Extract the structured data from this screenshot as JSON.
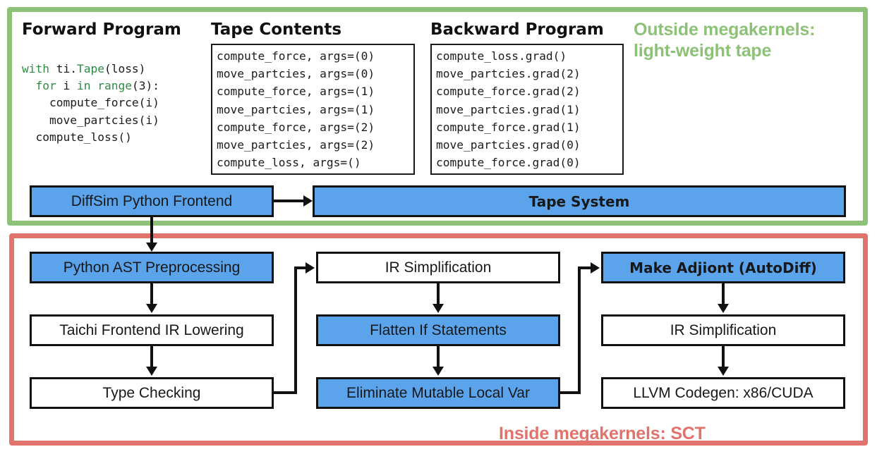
{
  "colors": {
    "green": "#8CC177",
    "red": "#E0736B",
    "blue": "#5BA4EC",
    "outline": "#111111",
    "code_keyword": "#2E8B45"
  },
  "regions": {
    "outside": {
      "annotation": "Outside megakernels:\nlight-weight tape"
    },
    "inside": {
      "annotation": "Inside megakernels: SCT"
    }
  },
  "columns": {
    "forward": {
      "heading": "Forward Program",
      "code_lines": [
        "with ti.Tape(loss)",
        "  for i in range(3):",
        "    compute_force(i)",
        "    move_partcies(i)",
        "  compute_loss()"
      ],
      "code_text": "with ti.Tape(loss)\n  for i in range(3):\n    compute_force(i)\n    move_partcies(i)\n  compute_loss()"
    },
    "tape": {
      "heading": "Tape Contents",
      "entries": [
        "compute_force, args=(0)",
        "move_partcies, args=(0)",
        "compute_force, args=(1)",
        "move_partcies, args=(1)",
        "compute_force, args=(2)",
        "move_partcies, args=(2)",
        "compute_loss, args=()"
      ],
      "entries_text": "compute_force, args=(0)\nmove_partcies, args=(0)\ncompute_force, args=(1)\nmove_partcies, args=(1)\ncompute_force, args=(2)\nmove_partcies, args=(2)\ncompute_loss, args=()"
    },
    "backward": {
      "heading": "Backward Program",
      "entries": [
        "compute_loss.grad()",
        "move_partcies.grad(2)",
        "compute_force.grad(2)",
        "move_partcies.grad(1)",
        "compute_force.grad(1)",
        "move_partcies.grad(0)",
        "compute_force.grad(0)"
      ],
      "entries_text": "compute_loss.grad()\nmove_partcies.grad(2)\ncompute_force.grad(2)\nmove_partcies.grad(1)\ncompute_force.grad(1)\nmove_partcies.grad(0)\ncompute_force.grad(0)"
    }
  },
  "nodes": {
    "frontend": {
      "label": "DiffSim Python Frontend",
      "fill": "blue"
    },
    "tape_system": {
      "label": "Tape System",
      "fill": "blue"
    },
    "ast": {
      "label": "Python AST Preprocessing",
      "fill": "blue"
    },
    "lowering": {
      "label": "Taichi Frontend IR Lowering",
      "fill": "white"
    },
    "typecheck": {
      "label": "Type Checking",
      "fill": "white"
    },
    "ir_simplification_1": {
      "label": "IR Simplification",
      "fill": "white"
    },
    "flatten": {
      "label": "Flatten If Statements",
      "fill": "blue"
    },
    "eliminate": {
      "label": "Eliminate Mutable Local Var",
      "fill": "blue"
    },
    "adjoint": {
      "label": "Make Adjiont (AutoDiff)",
      "fill": "blue"
    },
    "ir_simplification_2": {
      "label": "IR Simplification",
      "fill": "white"
    },
    "llvm": {
      "label": "LLVM Codegen: x86/CUDA",
      "fill": "white"
    }
  },
  "edges": [
    {
      "from": "frontend",
      "to": "tape_system"
    },
    {
      "from": "frontend",
      "to": "ast"
    },
    {
      "from": "ast",
      "to": "lowering"
    },
    {
      "from": "lowering",
      "to": "typecheck"
    },
    {
      "from": "typecheck",
      "to": "ir_simplification_1"
    },
    {
      "from": "ir_simplification_1",
      "to": "flatten"
    },
    {
      "from": "flatten",
      "to": "eliminate"
    },
    {
      "from": "eliminate",
      "to": "adjoint"
    },
    {
      "from": "adjoint",
      "to": "ir_simplification_2"
    },
    {
      "from": "ir_simplification_2",
      "to": "llvm"
    }
  ]
}
